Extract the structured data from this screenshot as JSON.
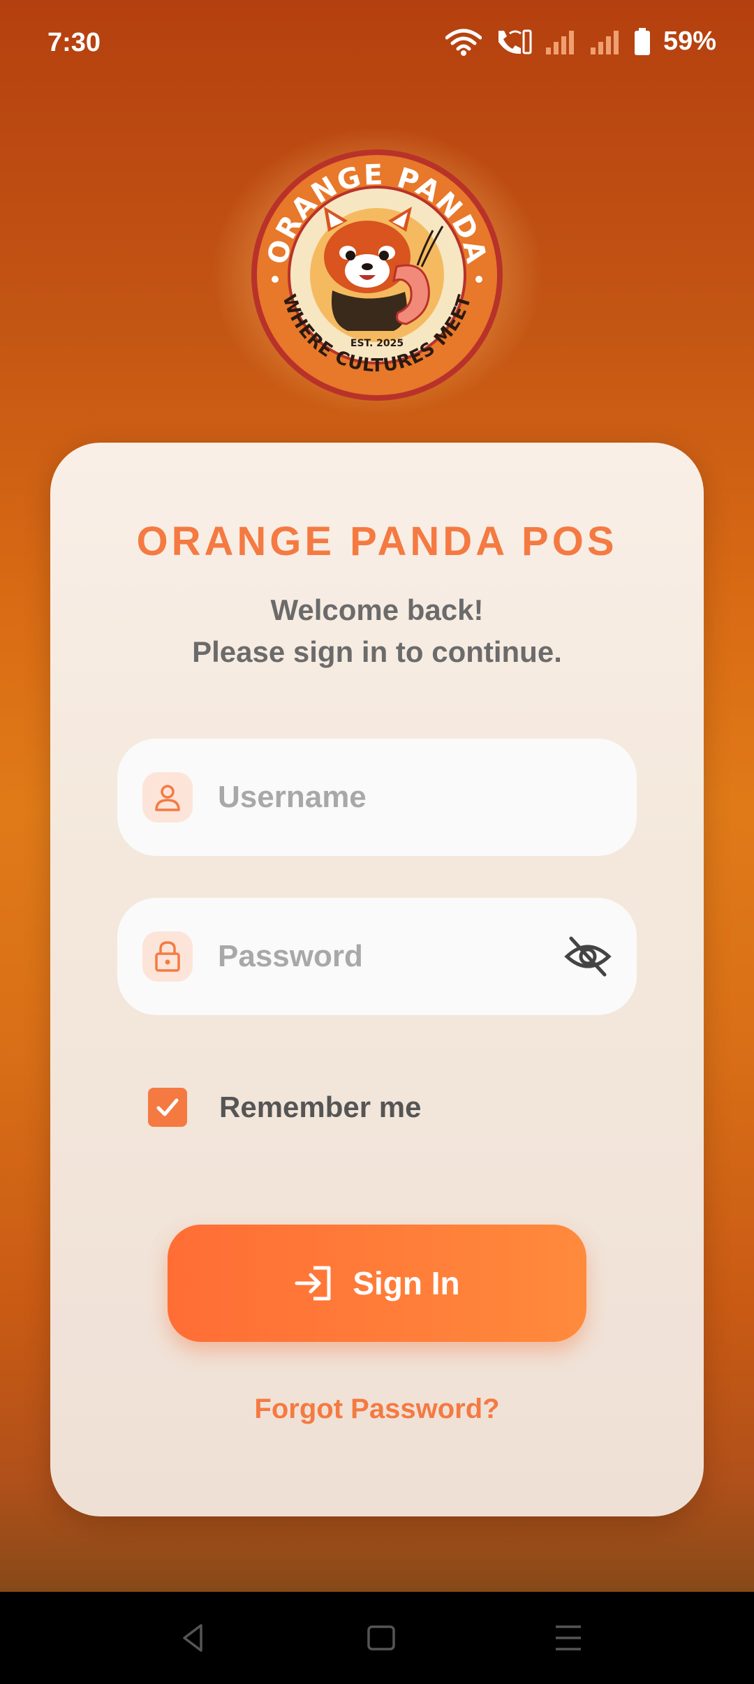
{
  "status_bar": {
    "time": "7:30",
    "battery": "59%",
    "icons": [
      "wifi-icon",
      "wifi-calling-icon",
      "signal-1-icon",
      "signal-2-icon",
      "battery-icon"
    ]
  },
  "logo": {
    "top_text": "ORANGE PANDA",
    "bottom_text": "WHERE CULTURES MEET",
    "est_text": "EST. 2025"
  },
  "card": {
    "title": "ORANGE PANDA POS",
    "welcome_line1": "Welcome back!",
    "welcome_line2": "Please sign in to continue."
  },
  "form": {
    "username": {
      "placeholder": "Username",
      "value": "",
      "icon": "person-icon"
    },
    "password": {
      "placeholder": "Password",
      "value": "",
      "icon": "lock-icon",
      "toggle_icon": "eye-off-icon"
    },
    "remember_me": {
      "label": "Remember me",
      "checked": true
    },
    "sign_in_label": "Sign In",
    "sign_in_icon": "login-icon",
    "forgot_password": "Forgot Password?"
  },
  "nav_bar": {
    "buttons": [
      "back-icon",
      "home-icon",
      "recents-icon"
    ]
  },
  "colors": {
    "accent": "#f47a42",
    "button_start": "#ff6d35",
    "button_end": "#ff8a3c",
    "background_top": "#b5400f",
    "background_mid": "#e07a18"
  }
}
